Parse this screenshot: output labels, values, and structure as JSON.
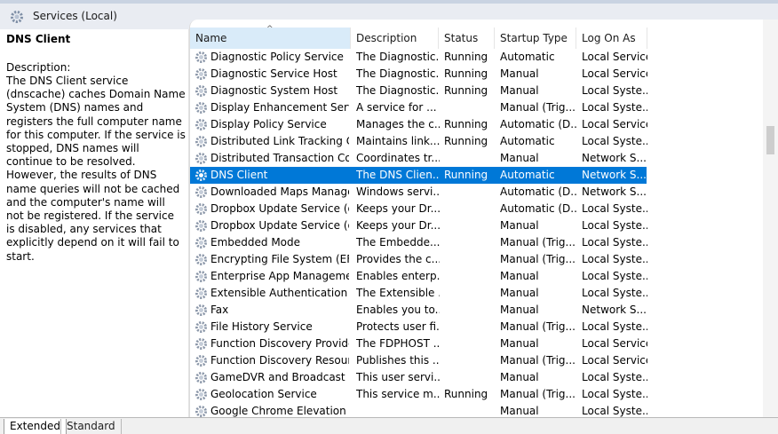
{
  "window": {
    "title": "Services (Local)"
  },
  "description_pane": {
    "service_name": "DNS Client",
    "label": "Description:",
    "text": "The DNS Client service (dnscache) caches Domain Name System (DNS) names and registers the full computer name for this computer. If the service is stopped, DNS names will continue to be resolved. However, the results of DNS name queries will not be cached and the computer's name will not be registered. If the service is disabled, any services that explicitly depend on it will fail to start."
  },
  "columns": [
    "Name",
    "Description",
    "Status",
    "Startup Type",
    "Log On As"
  ],
  "services": [
    {
      "name": "Diagnostic Policy Service",
      "description": "The Diagnostic...",
      "status": "Running",
      "startup": "Automatic",
      "logon": "Local Service"
    },
    {
      "name": "Diagnostic Service Host",
      "description": "The Diagnostic...",
      "status": "Running",
      "startup": "Manual",
      "logon": "Local Service"
    },
    {
      "name": "Diagnostic System Host",
      "description": "The Diagnostic...",
      "status": "Running",
      "startup": "Manual",
      "logon": "Local Syste..."
    },
    {
      "name": "Display Enhancement Service",
      "description": "A service for ...",
      "status": "",
      "startup": "Manual (Trig...",
      "logon": "Local Syste..."
    },
    {
      "name": "Display Policy Service",
      "description": "Manages the c...",
      "status": "Running",
      "startup": "Automatic (D...",
      "logon": "Local Service"
    },
    {
      "name": "Distributed Link Tracking Cli...",
      "description": "Maintains link...",
      "status": "Running",
      "startup": "Automatic",
      "logon": "Local Syste..."
    },
    {
      "name": "Distributed Transaction Coo...",
      "description": "Coordinates tr...",
      "status": "",
      "startup": "Manual",
      "logon": "Network S..."
    },
    {
      "name": "DNS Client",
      "description": "The DNS Clien...",
      "status": "Running",
      "startup": "Automatic",
      "logon": "Network S...",
      "selected": true
    },
    {
      "name": "Downloaded Maps Manager",
      "description": "Windows servi...",
      "status": "",
      "startup": "Automatic (D...",
      "logon": "Network S..."
    },
    {
      "name": "Dropbox Update Service (d...",
      "description": "Keeps your Dr...",
      "status": "",
      "startup": "Automatic (D...",
      "logon": "Local Syste..."
    },
    {
      "name": "Dropbox Update Service (d...",
      "description": "Keeps your Dr...",
      "status": "",
      "startup": "Manual",
      "logon": "Local Syste..."
    },
    {
      "name": "Embedded Mode",
      "description": "The Embedde...",
      "status": "",
      "startup": "Manual (Trig...",
      "logon": "Local Syste..."
    },
    {
      "name": "Encrypting File System (EFS)",
      "description": "Provides the c...",
      "status": "",
      "startup": "Manual (Trig...",
      "logon": "Local Syste..."
    },
    {
      "name": "Enterprise App Managemen...",
      "description": "Enables enterp...",
      "status": "",
      "startup": "Manual",
      "logon": "Local Syste..."
    },
    {
      "name": "Extensible Authentication P...",
      "description": "The Extensible ...",
      "status": "",
      "startup": "Manual",
      "logon": "Local Syste..."
    },
    {
      "name": "Fax",
      "description": "Enables you to...",
      "status": "",
      "startup": "Manual",
      "logon": "Network S..."
    },
    {
      "name": "File History Service",
      "description": "Protects user fi...",
      "status": "",
      "startup": "Manual (Trig...",
      "logon": "Local Syste..."
    },
    {
      "name": "Function Discovery Provide...",
      "description": "The FDPHOST ...",
      "status": "",
      "startup": "Manual",
      "logon": "Local Service"
    },
    {
      "name": "Function Discovery Resourc...",
      "description": "Publishes this ...",
      "status": "",
      "startup": "Manual (Trig...",
      "logon": "Local Service"
    },
    {
      "name": "GameDVR and Broadcast Us...",
      "description": "This user servi...",
      "status": "",
      "startup": "Manual",
      "logon": "Local Syste..."
    },
    {
      "name": "Geolocation Service",
      "description": "This service m...",
      "status": "Running",
      "startup": "Manual (Trig...",
      "logon": "Local Syste..."
    },
    {
      "name": "Google Chrome Elevation S...",
      "description": "",
      "status": "",
      "startup": "Manual",
      "logon": "Local Syste..."
    }
  ],
  "tabs": [
    "Extended",
    "Standard"
  ],
  "colors": {
    "selection": "#0078d7",
    "sorted_header": "#d9ebf9"
  },
  "icons": {
    "service_row": "gear-icon",
    "title": "gear-icon"
  }
}
